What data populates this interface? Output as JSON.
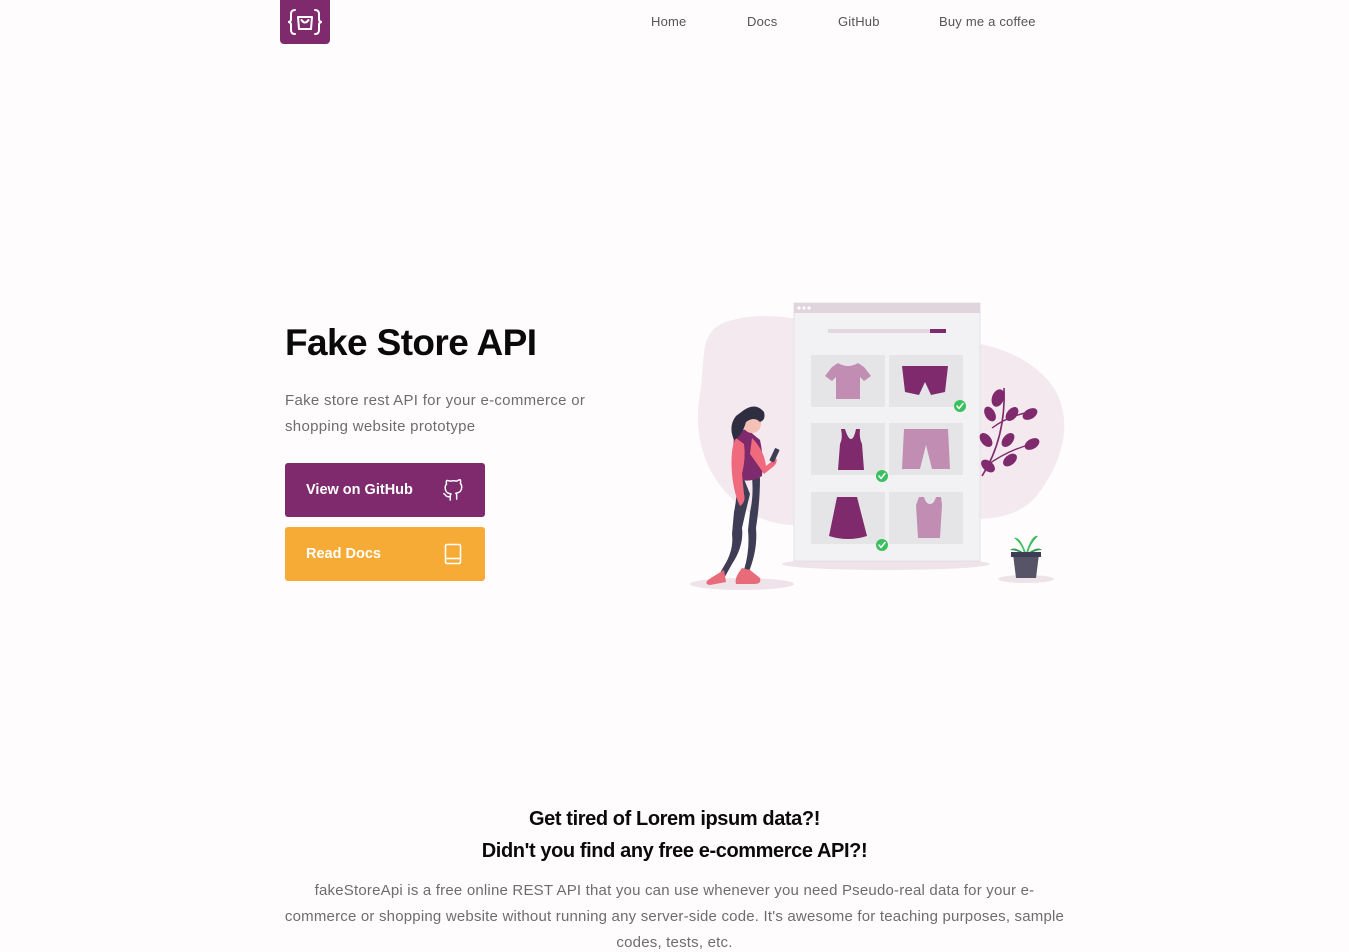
{
  "header": {
    "logo_icon": "shopping-bag-braces-icon",
    "nav": [
      {
        "label": "Home"
      },
      {
        "label": "Docs"
      },
      {
        "label": "GitHub"
      },
      {
        "label": "Buy me a coffee"
      }
    ]
  },
  "hero": {
    "title": "Fake Store API",
    "description": "Fake store rest API for your e-commerce or shopping website prototype",
    "buttons": {
      "github": {
        "label": "View on GitHub",
        "icon": "github-icon"
      },
      "docs": {
        "label": "Read Docs",
        "icon": "book-icon"
      }
    },
    "illustration": "online-shopping-illustration"
  },
  "intro": {
    "heading_line1": "Get tired of Lorem ipsum data?!",
    "heading_line2": "Didn't you find any free e-commerce API?!",
    "text": "fakeStoreApi is a free online REST API that you can use whenever you need Pseudo-real data for your e-commerce or shopping website without running any server-side code. It's awesome for teaching purposes, sample codes, tests, etc."
  },
  "colors": {
    "brand_purple": "#7e2a6c",
    "accent_orange": "#f6ab36",
    "background": "#fffcfd",
    "text_dark": "#0a0a0a",
    "text_muted": "#6d6d6d"
  }
}
